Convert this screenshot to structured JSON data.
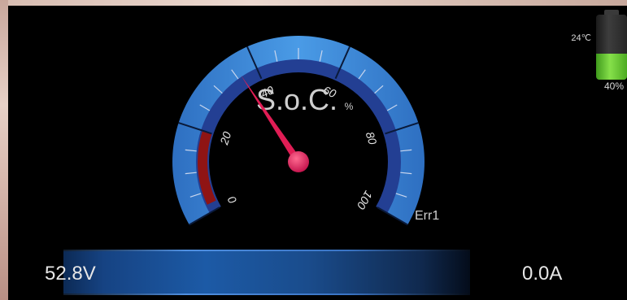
{
  "gauge": {
    "title": "S.o.C.",
    "unit": "%",
    "ticks": [
      "0",
      "20",
      "40",
      "60",
      "80",
      "100"
    ],
    "min": 0,
    "max": 100,
    "value": 36
  },
  "status": {
    "temperature": "24℃",
    "battery_percent_label": "40%",
    "battery_level": 0.4,
    "error": "Err1"
  },
  "readouts": {
    "voltage": "52.8V",
    "current": "0.0A"
  },
  "colors": {
    "gauge_outer": "#3d86d6",
    "gauge_inner": "#2a4fa8",
    "gauge_red_zone": "#a11a1a",
    "needle": "#e01d55",
    "battery_green": "#7ed640",
    "bar_blue": "#1c5aa6"
  }
}
